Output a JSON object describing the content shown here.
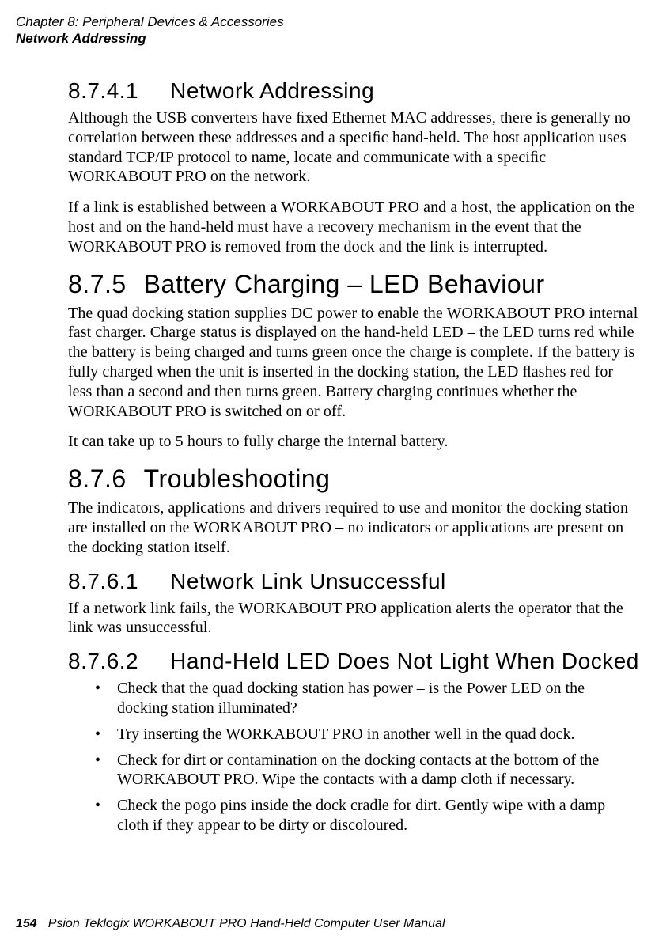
{
  "header": {
    "chapter": "Chapter  8:  Peripheral Devices & Accessories",
    "section": "Network Addressing"
  },
  "sections": {
    "s1": {
      "num": "8.7.4.1",
      "title": "Network Addressing",
      "p1": "Although the USB converters have ﬁxed Ethernet MAC addresses, there is generally no correlation between these addresses and a speciﬁc hand-held. The host application uses standard TCP/IP protocol to name, locate and communicate with a speciﬁc WORKABOUT PRO on the network.",
      "p2": "If a link is established between a WORKABOUT PRO and a host, the application on the host and on the hand-held must have a recovery mechanism in the event that the WORKABOUT PRO is removed from the dock and the link is interrupted."
    },
    "s2": {
      "num": "8.7.5",
      "title": "Battery Charging – LED Behaviour",
      "p1": "The quad docking station supplies DC power to enable the WORKABOUT PRO internal fast charger. Charge status is displayed on the hand-held LED – the LED turns red while the battery is being charged and turns green once the charge is complete. If the battery is fully charged when the unit is inserted in the docking station, the LED ﬂashes red for less than a second and then turns green. Battery charging continues whether the WORKABOUT PRO is switched on or off.",
      "p2": "It can take up to 5 hours to fully charge the internal battery."
    },
    "s3": {
      "num": "8.7.6",
      "title": "Troubleshooting",
      "p1": "The indicators, applications and drivers required to use and monitor the docking station are installed on the WORKABOUT PRO – no indicators or applications are present on the docking station itself."
    },
    "s4": {
      "num": "8.7.6.1",
      "title": "Network Link Unsuccessful",
      "p1": "If a network link fails, the WORKABOUT PRO application alerts the operator that the link was unsuccessful."
    },
    "s5": {
      "num": "8.7.6.2",
      "title": "Hand-Held LED Does Not Light When Docked",
      "bullets": [
        "Check that the quad docking station has power – is the Power LED on the docking station illuminated?",
        "Try inserting the WORKABOUT PRO in another well in the quad dock.",
        "Check for dirt or contamination on the docking contacts at the bottom of the WORKABOUT PRO. Wipe the contacts with a damp cloth if necessary.",
        "Check the pogo pins inside the dock cradle for dirt. Gently wipe with a damp cloth if they appear to be dirty or discoloured."
      ]
    }
  },
  "footer": {
    "pagenum": "154",
    "text": "Psion Teklogix WORKABOUT PRO Hand-Held Computer User Manual"
  }
}
